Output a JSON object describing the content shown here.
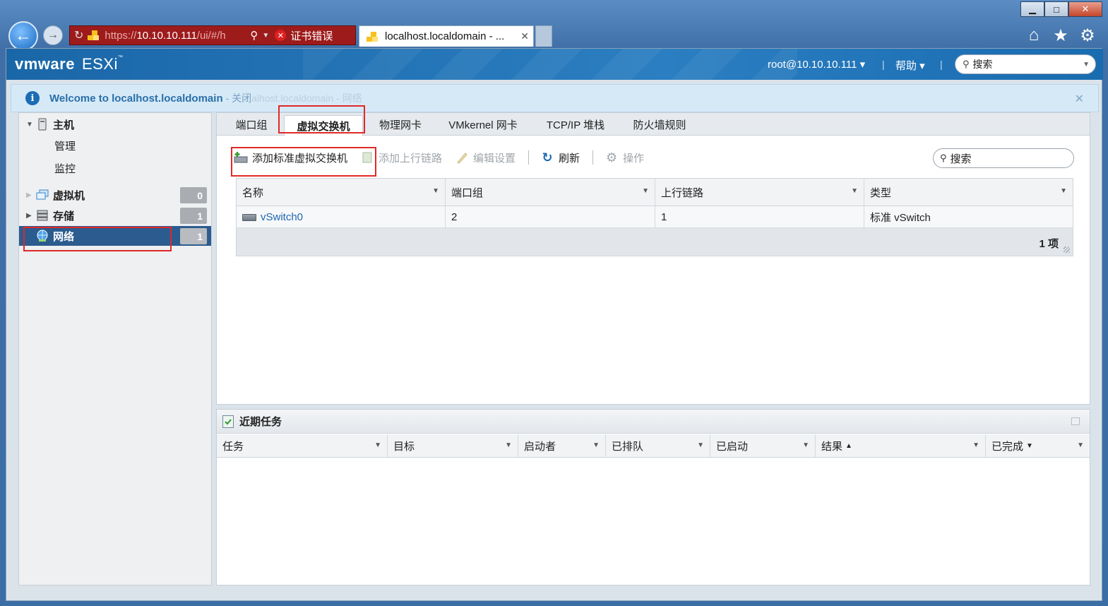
{
  "browser": {
    "window_controls": {
      "minimize": "▁",
      "maximize": "□",
      "close": "✕"
    },
    "address": {
      "url_prefix": "https://",
      "url_host": "10.10.10.111",
      "url_rest": "/ui/#/h",
      "cert_error": "证书错误"
    },
    "tab": {
      "title": "localhost.localdomain - ...",
      "close": "✕"
    }
  },
  "header": {
    "logo_vm": "vmware",
    "logo_product": "ESXi",
    "logo_tm": "™",
    "user": "root@10.10.10.111 ▾",
    "help": "帮助 ▾",
    "separator": "|",
    "search_placeholder": "搜索"
  },
  "welcome": {
    "message": "Welcome to localhost.localdomain",
    "close_link": "- 关闭",
    "ghost_text": "alhost.localdomain - 网络"
  },
  "sidebar": {
    "host": {
      "label": "主机",
      "children": [
        "管理",
        "监控"
      ]
    },
    "items": [
      {
        "label": "虚拟机",
        "count": "0"
      },
      {
        "label": "存储",
        "count": "1"
      },
      {
        "label": "网络",
        "count": "1"
      }
    ]
  },
  "main": {
    "tabs": [
      "端口组",
      "虚拟交换机",
      "物理网卡",
      "VMkernel 网卡",
      "TCP/IP 堆栈",
      "防火墙规则"
    ],
    "active_tab": "虚拟交换机",
    "toolbar": {
      "add_vswitch": "添加标准虚拟交换机",
      "add_uplink": "添加上行链路",
      "edit_settings": "编辑设置",
      "refresh": "刷新",
      "actions": "操作",
      "search_placeholder": "搜索"
    },
    "grid": {
      "columns": [
        "名称",
        "端口组",
        "上行链路",
        "类型"
      ],
      "rows": [
        {
          "name": "vSwitch0",
          "port_groups": "2",
          "uplinks": "1",
          "type": "标准 vSwitch"
        }
      ],
      "footer_count": "1 项"
    }
  },
  "tasks": {
    "title": "近期任务",
    "columns": [
      "任务",
      "目标",
      "启动者",
      "已排队",
      "已启动",
      "结果",
      "已完成"
    ],
    "sort_result": "▲",
    "sort_completed": "▼"
  },
  "colors": {
    "header_blue": "#1a67a8",
    "selected_nav": "#2c5c8f",
    "highlight_red": "#e02828",
    "link_blue": "#1d67b0",
    "cert_error_red": "#9e1b1b"
  }
}
